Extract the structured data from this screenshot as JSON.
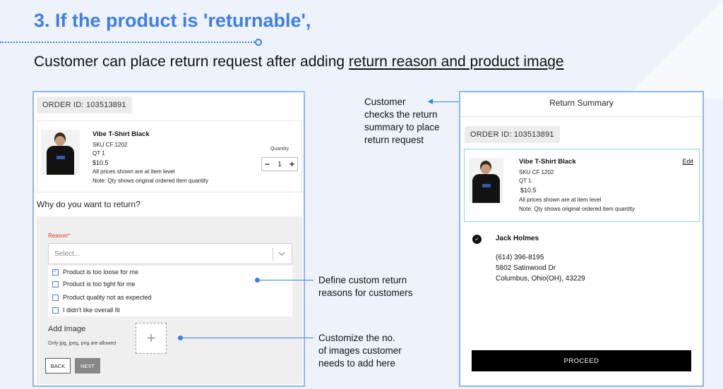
{
  "heading": "3. If the product is 'returnable',",
  "subheading": {
    "prefix": "Customer can place return request after adding ",
    "underlined": "return reason and product image"
  },
  "return_form": {
    "order_id": "ORDER ID: 103513891",
    "product": {
      "name": "Vibe T-Shirt Black",
      "sku": "SKU CF 1202",
      "qty_text": "QT 1",
      "price": "$10.5",
      "price_note": "All prices shown are at item level",
      "qty_note": "Note: Qty shows original ordered item quantity"
    },
    "quantity_label": "Quantity",
    "quantity_value": "1",
    "decrement": "−",
    "increment": "+",
    "question": "Why do you want to return?",
    "reason_label": "Reason*",
    "select_placeholder": "Select...",
    "options": [
      {
        "label": "Product is too loose for me",
        "checked": true
      },
      {
        "label": "Product is too tight for me",
        "checked": false
      },
      {
        "label": "Product quality not as expected",
        "checked": false
      },
      {
        "label": "I didn't like overall fit",
        "checked": false
      }
    ],
    "add_image_label": "Add Image",
    "image_note": "Only jpg, jpeg, png are allowed",
    "add_glyph": "+",
    "back_button": "BACK",
    "next_button": "NEXT"
  },
  "annotations": {
    "reasons": [
      "Define custom return",
      "reasons for customers"
    ],
    "images": [
      "Customize the no.",
      "of images customer",
      "needs to add here"
    ],
    "summary": [
      "Customer",
      "checks the return",
      "summary to place",
      "return request"
    ]
  },
  "return_summary": {
    "title": "Return Summary",
    "order_id": "ORDER ID: 103513891",
    "edit_link": "Edit",
    "product": {
      "name": "Vibe T-Shirt Black",
      "sku": "SKU CF 1202",
      "qty_text": "QT 1",
      "price": "$10.5",
      "price_note": "All prices shown are at item level",
      "qty_note": "Note: Qty shows original ordered item quantity"
    },
    "address": {
      "name": "Jack Holmes",
      "phone": "(614) 396-8195",
      "street": "5802 Satinwood Dr",
      "city": "Columbus, Ohio(OH), 43229"
    },
    "proceed_button": "PROCEED"
  },
  "colors": {
    "accent": "#3f7ee6",
    "panel_border": "#8fb3ef",
    "summary_card_border": "#88dbd4",
    "reason_required": "#e0322d",
    "background": "#eef3fb"
  },
  "icons": [
    "check-icon",
    "chevron-down-icon",
    "plus-icon",
    "check-circle-icon"
  ]
}
